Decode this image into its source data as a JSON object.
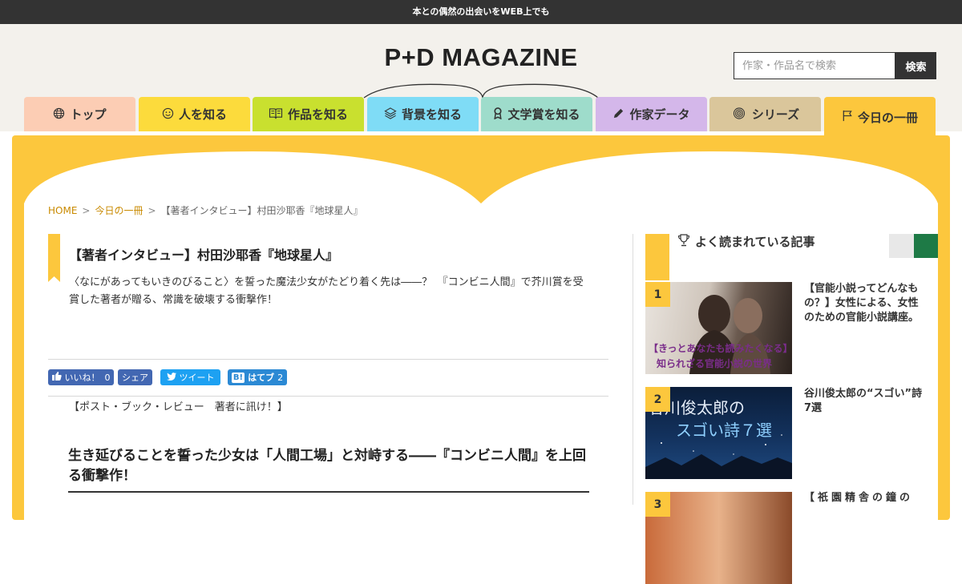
{
  "topbar": {
    "tagline": "本との偶然の出会いをWEB上でも"
  },
  "header": {
    "logo_text": "P+D MAGAZINE",
    "search": {
      "placeholder": "作家・作品名で検索",
      "button_label": "検索"
    }
  },
  "nav": {
    "tabs": [
      {
        "label": "トップ",
        "icon": "globe-icon",
        "color": "#fccdb4"
      },
      {
        "label": "人を知る",
        "icon": "smiley-icon",
        "color": "#fcdb3c"
      },
      {
        "label": "作品を知る",
        "icon": "book-icon",
        "color": "#c9e02f"
      },
      {
        "label": "背景を知る",
        "icon": "layers-icon",
        "color": "#7fdcf6"
      },
      {
        "label": "文学賞を知る",
        "icon": "award-icon",
        "color": "#9edccb"
      },
      {
        "label": "作家データ",
        "icon": "pen-icon",
        "color": "#d4b7ea"
      },
      {
        "label": "シリーズ",
        "icon": "spiral-icon",
        "color": "#dac69b"
      },
      {
        "label": "今日の一冊",
        "icon": "flag-icon",
        "color": "#fcc73d",
        "active": true
      }
    ]
  },
  "breadcrumb": {
    "home": "HOME",
    "section": "今日の一冊",
    "current": "【著者インタビュー】村田沙耶香『地球星人』"
  },
  "article": {
    "title": "【著者インタビュー】村田沙耶香『地球星人』",
    "lead": "〈なにがあってもいきのびること〉を誓った魔法少女がたどり着く先は――？　『コンビニ人間』で芥川賞を受賞した著者が贈る、常識を破壊する衝撃作！",
    "share": {
      "like_label": "いいね！",
      "like_count": "0",
      "fb_share_label": "シェア",
      "tweet_label": "ツイート",
      "hatena_label": "はてブ",
      "hatena_count": "2"
    },
    "series_label": "【ポスト・ブック・レビュー　著者に訊け！】",
    "subheading": "生き延びることを誓った少女は「人間工場」と対峙する――『コンビニ人間』を上回る衝撃作！"
  },
  "sidebar": {
    "popular_heading": "よく読まれている記事",
    "popular_icon": "trophy-icon",
    "items": [
      {
        "rank": "1",
        "title": "【官能小説ってどんなもの？】女性による、女性のための官能小説講座。",
        "thumb_caption_1": "【きっとあなたも読みたくなる】",
        "thumb_caption_2": "知られざる官能小説の世界"
      },
      {
        "rank": "2",
        "title": "谷川俊太郎の“スゴい”詩7選",
        "thumb_caption_1": "谷川俊太郎の",
        "thumb_caption_2": "スゴい詩７選"
      },
      {
        "rank": "3",
        "title": "【祇園精舎の鐘の"
      }
    ]
  }
}
